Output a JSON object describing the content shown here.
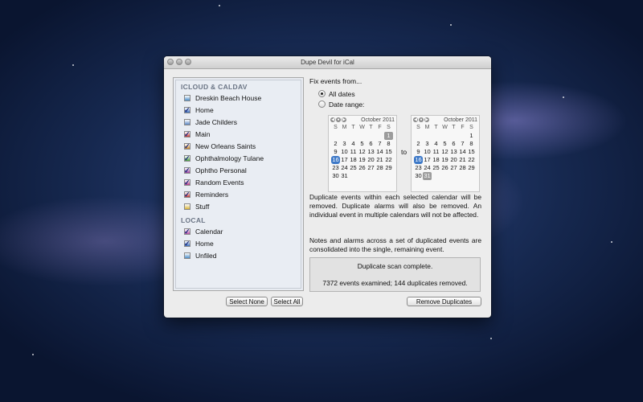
{
  "window": {
    "title": "Dupe Devil for iCal"
  },
  "sidebar": {
    "sections": [
      {
        "title": "ICLOUD & CALDAV",
        "items": [
          {
            "label": "Dreskin Beach House",
            "checked": false,
            "color": "#4d8dc9"
          },
          {
            "label": "Home",
            "checked": true,
            "color": "#3b6fbf"
          },
          {
            "label": "Jade Childers",
            "checked": false,
            "color": "#5a86c2"
          },
          {
            "label": "Main",
            "checked": true,
            "color": "#c93b3b"
          },
          {
            "label": "New Orleans Saints",
            "checked": true,
            "color": "#d08a2b"
          },
          {
            "label": "Ophthalmology Tulane",
            "checked": true,
            "color": "#4aa23f"
          },
          {
            "label": "Ophtho Personal",
            "checked": true,
            "color": "#9a3fa0"
          },
          {
            "label": "Random Events",
            "checked": true,
            "color": "#b53a8a"
          },
          {
            "label": "Reminders",
            "checked": true,
            "color": "#c63a3a"
          },
          {
            "label": "Stuff",
            "checked": false,
            "color": "#d8b43a"
          }
        ]
      },
      {
        "title": "LOCAL",
        "items": [
          {
            "label": "Calendar",
            "checked": true,
            "color": "#b84ea8"
          },
          {
            "label": "Home",
            "checked": true,
            "color": "#3b6fbf"
          },
          {
            "label": "Unfiled",
            "checked": false,
            "color": "#4d8dc9"
          }
        ]
      }
    ]
  },
  "buttons": {
    "select_none": "Select None",
    "select_all": "Select All",
    "remove": "Remove Duplicates"
  },
  "fix": {
    "heading": "Fix events from...",
    "all_dates": "All dates",
    "date_range": "Date range:",
    "selected": "All dates",
    "to_label": "to"
  },
  "calendars": {
    "month": "October 2011",
    "dow": [
      "S",
      "M",
      "T",
      "W",
      "T",
      "F",
      "S"
    ],
    "weeks": [
      [
        "",
        "",
        "",
        "",
        "",
        "",
        "1"
      ],
      [
        "2",
        "3",
        "4",
        "5",
        "6",
        "7",
        "8"
      ],
      [
        "9",
        "10",
        "11",
        "12",
        "13",
        "14",
        "15"
      ],
      [
        "16",
        "17",
        "18",
        "19",
        "20",
        "21",
        "22"
      ],
      [
        "23",
        "24",
        "25",
        "26",
        "27",
        "28",
        "29"
      ],
      [
        "30",
        "31",
        "",
        "",
        "",
        "",
        ""
      ]
    ],
    "today": "16",
    "from_mark": "1",
    "to_mark": "31"
  },
  "description": {
    "p1": "Duplicate events within each selected calendar will be removed. Duplicate alarms will also be removed. An individual event in multiple calendars will not be affected.",
    "p2": "Notes and alarms across a set of duplicated events are consolidated into the single, remaining event."
  },
  "status": {
    "line1": "Duplicate scan complete.",
    "line2": "7372 events examined; 144 duplicates removed."
  }
}
